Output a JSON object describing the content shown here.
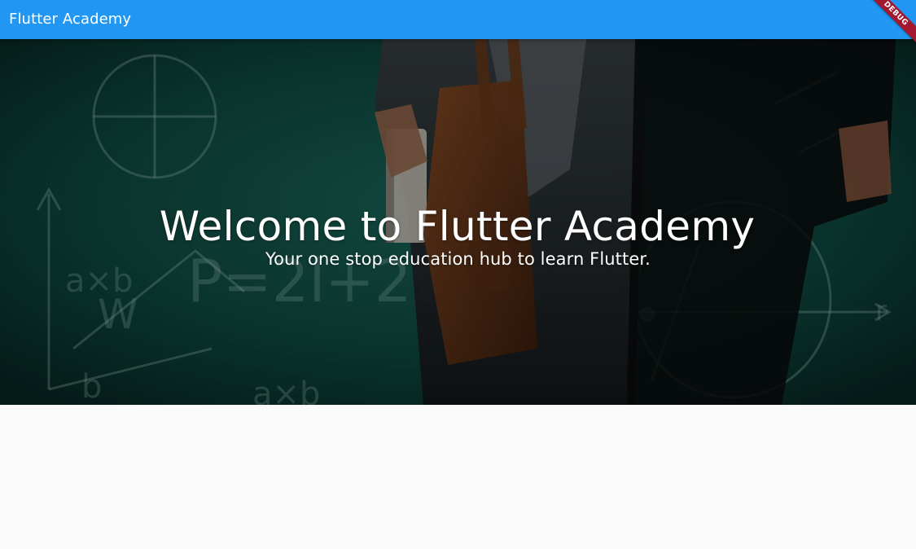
{
  "app_bar": {
    "title": "Flutter Academy",
    "color": "#2196f3"
  },
  "debug_banner": {
    "label": "DEBUG",
    "color": "#a3182f"
  },
  "hero": {
    "title": "Welcome to Flutter Academy",
    "subtitle": "Your one stop education hub to learn Flutter."
  },
  "colors": {
    "background": "#fafafa",
    "text_on_primary": "#ffffff"
  }
}
